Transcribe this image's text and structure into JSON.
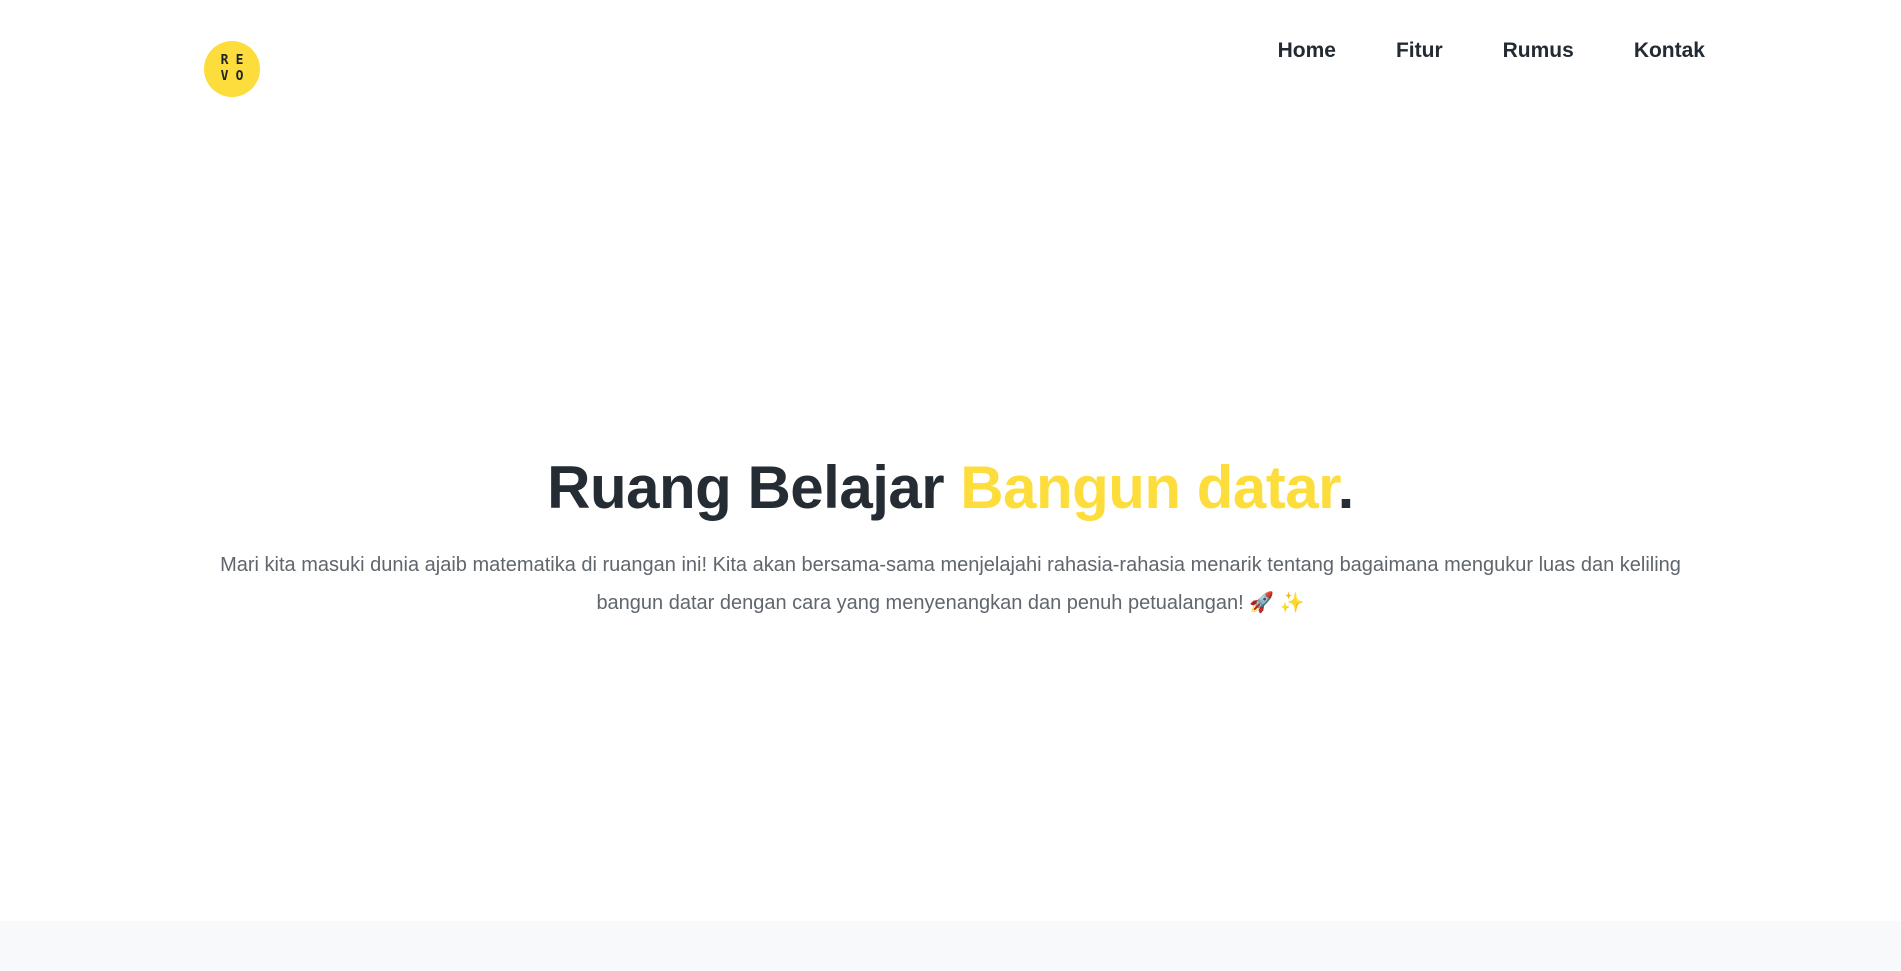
{
  "header": {
    "logo": {
      "letters": [
        "R",
        "E",
        "V",
        "O"
      ],
      "color": "#fddd3b"
    },
    "nav": [
      {
        "label": "Home"
      },
      {
        "label": "Fitur"
      },
      {
        "label": "Rumus"
      },
      {
        "label": "Kontak"
      }
    ]
  },
  "hero": {
    "title_main": "Ruang Belajar ",
    "title_accent": "Bangun datar",
    "title_end": ".",
    "description": "Mari kita masuki dunia ajaib matematika di ruangan ini! Kita akan bersama-sama menjelajahi rahasia-rahasia menarik tentang bagaimana mengukur luas dan keliling bangun datar dengan cara yang menyenangkan dan penuh petualangan! 🚀 ✨"
  },
  "colors": {
    "accent": "#fddd3b",
    "heading": "#252c33",
    "body_text": "#5f666d",
    "footer_bg": "#f8f9fa"
  }
}
